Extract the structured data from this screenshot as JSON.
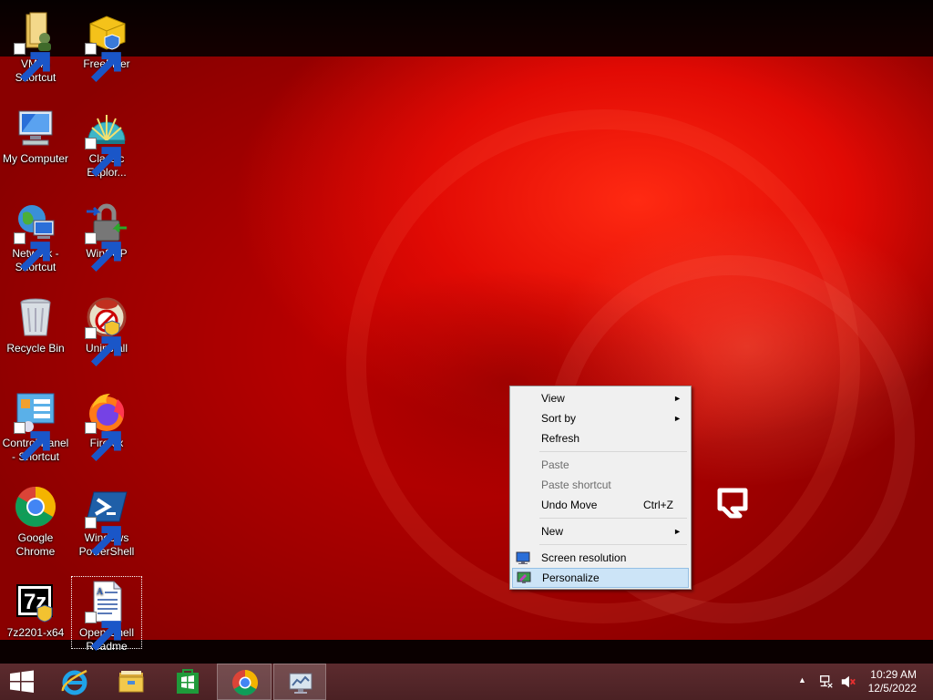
{
  "desktop": {
    "icons": [
      {
        "label": "VM4 - Shortcut",
        "icon": "folder-user-icon"
      },
      {
        "label": "FreeFixer",
        "icon": "freefixer-icon"
      },
      {
        "label": "My Computer",
        "icon": "computer-icon"
      },
      {
        "label": "Classic Explor...",
        "icon": "shell-icon"
      },
      {
        "label": "Network - Shortcut",
        "icon": "network-globe-icon"
      },
      {
        "label": "WinSCP",
        "icon": "lock-icon"
      },
      {
        "label": "Recycle Bin",
        "icon": "recycle-bin-icon"
      },
      {
        "label": "Uninstall",
        "icon": "uninstall-icon"
      },
      {
        "label": "Control Panel - Shortcut",
        "icon": "control-panel-icon"
      },
      {
        "label": "Firefox",
        "icon": "firefox-icon"
      },
      {
        "label": "Google Chrome",
        "icon": "chrome-icon"
      },
      {
        "label": "Windows PowerShell",
        "icon": "powershell-icon"
      },
      {
        "label": "7z2201-x64",
        "icon": "7zip-icon"
      },
      {
        "label": "Open-Shell Readme",
        "icon": "document-icon"
      }
    ]
  },
  "context_menu": {
    "view": "View",
    "sort_by": "Sort by",
    "refresh": "Refresh",
    "paste": "Paste",
    "paste_shortcut": "Paste shortcut",
    "undo_move": "Undo Move",
    "undo_shortcut": "Ctrl+Z",
    "new": "New",
    "screen_resolution": "Screen resolution",
    "personalize": "Personalize",
    "submenu_arrow": "►"
  },
  "taskbar": {
    "time": "10:29 AM",
    "date": "12/5/2022",
    "tray_expand": "▲"
  },
  "colors": {
    "taskbar": "#4f2326",
    "menu_highlight": "#cce4f7",
    "desktop_red": "#d10000"
  }
}
